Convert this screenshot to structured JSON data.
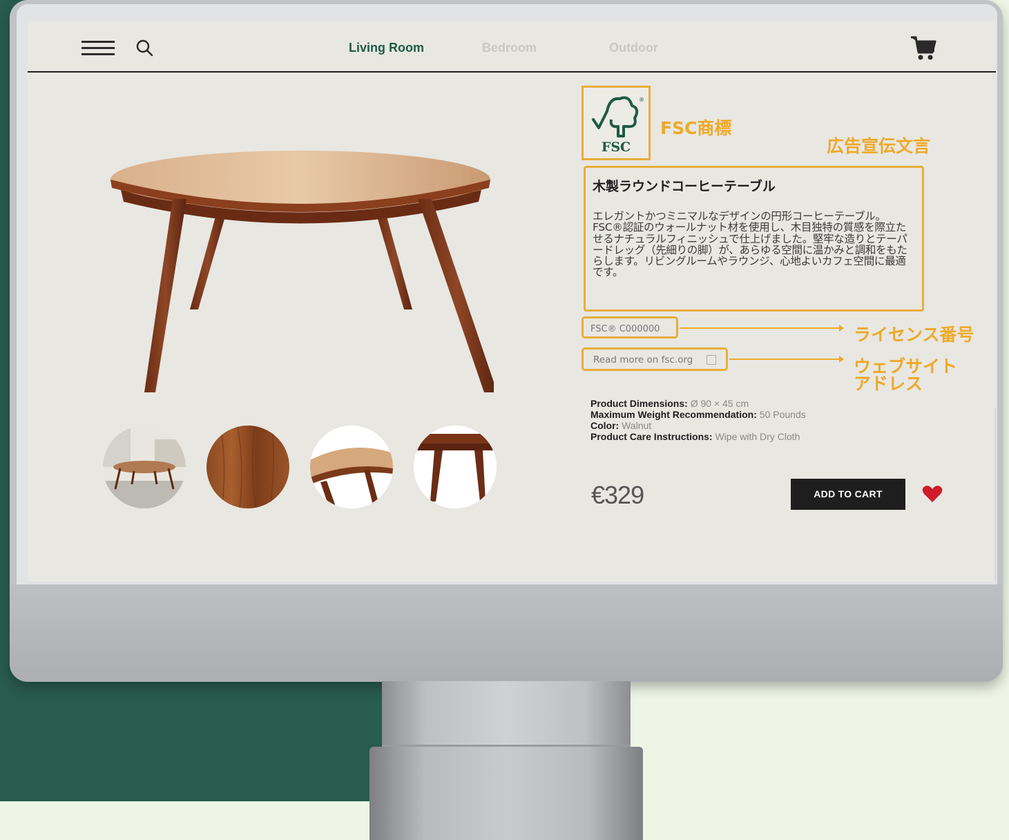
{
  "nav": {
    "tabs": [
      {
        "label": "Living Room",
        "active": true
      },
      {
        "label": "Bedroom",
        "active": false
      },
      {
        "label": "Outdoor",
        "active": false
      }
    ]
  },
  "fsc_logo": {
    "text": "FSC",
    "registered": "®"
  },
  "annotations": {
    "trademark": "FSC商標",
    "ad_copy": "広告宣伝文言",
    "license": "ライセンス番号",
    "website_line1": "ウェブサイト",
    "website_line2": "アドレス"
  },
  "product": {
    "title": "木製ラウンドコーヒーテーブル",
    "description": "エレガントかつミニマルなデザインの円形コーヒーテーブル。FSC®認証のウォールナット材を使用し、木目独特の質感を際立たせるナチュラルフィニッシュで仕上げました。堅牢な造りとテーパードレッグ（先細りの脚）が、あらゆる空間に温かみと調和をもたらします。リビングルームやラウンジ、心地よいカフェ空間に最適です。",
    "license_code": "FSC® C000000",
    "website_link": "Read more on fsc.org",
    "specs": [
      {
        "label": "Product Dimensions:",
        "value": "Ø 90 × 45 cm"
      },
      {
        "label": "Maximum Weight Recommendation:",
        "value": "50 Pounds"
      },
      {
        "label": "Color:",
        "value": "Walnut"
      },
      {
        "label": "Product Care Instructions:",
        "value": "Wipe with Dry Cloth"
      }
    ],
    "price": "€329",
    "add_to_cart": "ADD TO CART"
  },
  "colors": {
    "accent_green": "#1f5a45",
    "annotation_orange": "#eea928",
    "heart_red": "#d11a2a",
    "background_green": "#285c4d"
  },
  "icons": [
    "menu-icon",
    "search-icon",
    "cart-icon",
    "external-link-icon",
    "heart-icon",
    "fsc-tree-icon"
  ]
}
